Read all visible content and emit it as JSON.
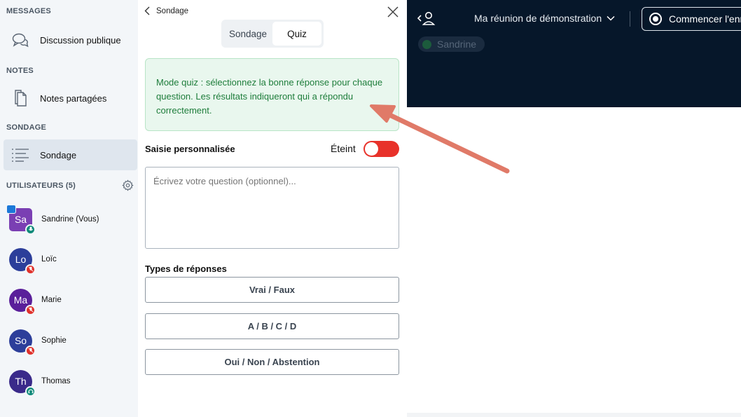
{
  "sidebar": {
    "messages_title": "MESSAGES",
    "public_chat_label": "Discussion publique",
    "notes_title": "NOTES",
    "shared_notes_label": "Notes partagées",
    "poll_title": "SONDAGE",
    "poll_label": "Sondage",
    "users_title": "UTILISATEURS (5)",
    "users": [
      {
        "initials": "Sa",
        "name": "Sandrine (Vous)",
        "color": "#7a3fb3",
        "status": "mic-on",
        "badge_color": "#0f8a7a"
      },
      {
        "initials": "Lo",
        "name": "Loïc",
        "color": "#2c3e9a",
        "status": "mic-muted",
        "badge_color": "#e0312b"
      },
      {
        "initials": "Ma",
        "name": "Marie",
        "color": "#5a1f9a",
        "status": "mic-muted",
        "badge_color": "#e0312b"
      },
      {
        "initials": "So",
        "name": "Sophie",
        "color": "#2c3e9a",
        "status": "mic-muted",
        "badge_color": "#e0312b"
      },
      {
        "initials": "Th",
        "name": "Thomas",
        "color": "#3a2a8a",
        "status": "listen-only",
        "badge_color": "#0f8a7a"
      }
    ]
  },
  "poll_panel": {
    "back_label": "Sondage",
    "tabs": [
      {
        "label": "Sondage",
        "active": false
      },
      {
        "label": "Quiz",
        "active": true
      }
    ],
    "quiz_info": "Mode quiz : sélectionnez la bonne réponse pour chaque question. Les résultats indiqueront qui a répondu correctement.",
    "custom_input_label": "Saisie personnalisée",
    "toggle_label": "Éteint",
    "toggle_on": false,
    "question_placeholder": "Écrivez votre question (optionnel)...",
    "response_types_label": "Types de réponses",
    "response_types": [
      "Vrai / Faux",
      "A / B / C / D",
      "Oui / Non / Abstention"
    ]
  },
  "topbar": {
    "meeting_title": "Ma réunion de démonstration",
    "record_label": "Commencer l'enregistrement",
    "talking_user": "Sandrine"
  },
  "colors": {
    "sidebar_bg": "#f3f6f9",
    "topbar_bg": "#06172a",
    "info_bg": "#e9f7ee",
    "info_text": "#1e7d3b",
    "toggle_off": "#e8322a",
    "annotation_arrow": "#e07a68"
  }
}
